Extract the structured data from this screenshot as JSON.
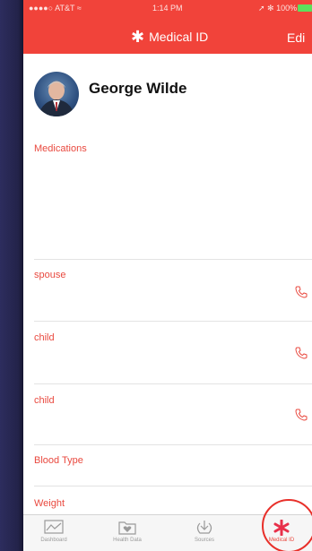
{
  "status_bar": {
    "carrier": "●●●●○ AT&T ≈",
    "time": "1:14 PM",
    "battery": "➚ ✻ 100%"
  },
  "header": {
    "title": "Medical ID",
    "edit_label": "Edi"
  },
  "profile": {
    "name": "George Wilde"
  },
  "sections": {
    "medications": "Medications",
    "contacts": [
      {
        "relation": "spouse"
      },
      {
        "relation": "child"
      },
      {
        "relation": "child"
      }
    ],
    "blood_type": "Blood Type",
    "weight": "Weight"
  },
  "tabs": [
    {
      "label": "Dashboard",
      "icon": "dashboard-icon"
    },
    {
      "label": "Health Data",
      "icon": "health-data-icon"
    },
    {
      "label": "Sources",
      "icon": "sources-icon"
    },
    {
      "label": "Medical ID",
      "icon": "medical-id-icon",
      "active": true
    }
  ],
  "colors": {
    "accent": "#f1433a",
    "label": "#e9493f",
    "highlight_ring": "#e8302a"
  }
}
